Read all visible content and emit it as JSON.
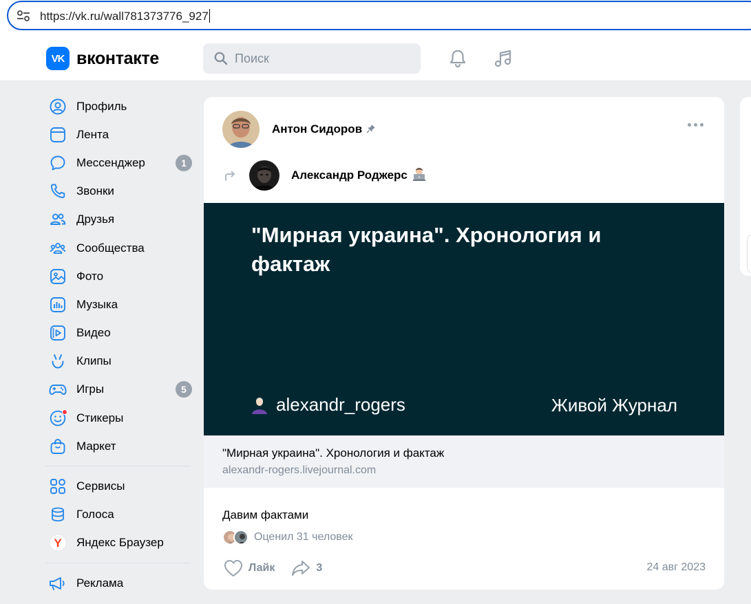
{
  "browser": {
    "url": "https://vk.ru/wall781373776_927"
  },
  "header": {
    "logo_text": "вконтакте",
    "logo_mark": "VK",
    "search_placeholder": "Поиск",
    "brand_color": "#0077ff"
  },
  "sidebar": {
    "items": [
      {
        "label": "Профиль",
        "icon": "user-circle-icon"
      },
      {
        "label": "Лента",
        "icon": "newsfeed-icon"
      },
      {
        "label": "Мессенджер",
        "icon": "message-icon",
        "badge": "1"
      },
      {
        "label": "Звонки",
        "icon": "phone-icon"
      },
      {
        "label": "Друзья",
        "icon": "friends-icon"
      },
      {
        "label": "Сообщества",
        "icon": "communities-icon"
      },
      {
        "label": "Фото",
        "icon": "photo-icon"
      },
      {
        "label": "Музыка",
        "icon": "music-icon"
      },
      {
        "label": "Видео",
        "icon": "video-icon"
      },
      {
        "label": "Клипы",
        "icon": "clips-icon"
      },
      {
        "label": "Игры",
        "icon": "gamepad-icon",
        "badge": "5"
      },
      {
        "label": "Стикеры",
        "icon": "smile-icon"
      },
      {
        "label": "Маркет",
        "icon": "bag-icon"
      }
    ],
    "items2": [
      {
        "label": "Сервисы",
        "icon": "services-icon"
      },
      {
        "label": "Голоса",
        "icon": "coins-icon"
      },
      {
        "label": "Яндекс Браузер",
        "icon": "yandex-icon"
      }
    ],
    "items3": [
      {
        "label": "Реклама",
        "icon": "megaphone-icon"
      }
    ]
  },
  "post": {
    "author": "Антон Сидоров",
    "repost_author": "Александр Роджерс",
    "banner": {
      "title": "\"Мирная украина\". Хронология и фактаж",
      "username": "alexandr_rogers",
      "site": "Живой Журнал",
      "bg_color": "#022731"
    },
    "link": {
      "title": "\"Мирная украина\". Хронология и фактаж",
      "url": "alexandr-rogers.livejournal.com"
    },
    "text": "Давим фактами",
    "likes_text": "Оценил 31 человек",
    "like_label": "Лайк",
    "share_count": "3",
    "date": "24 авг 2023"
  }
}
